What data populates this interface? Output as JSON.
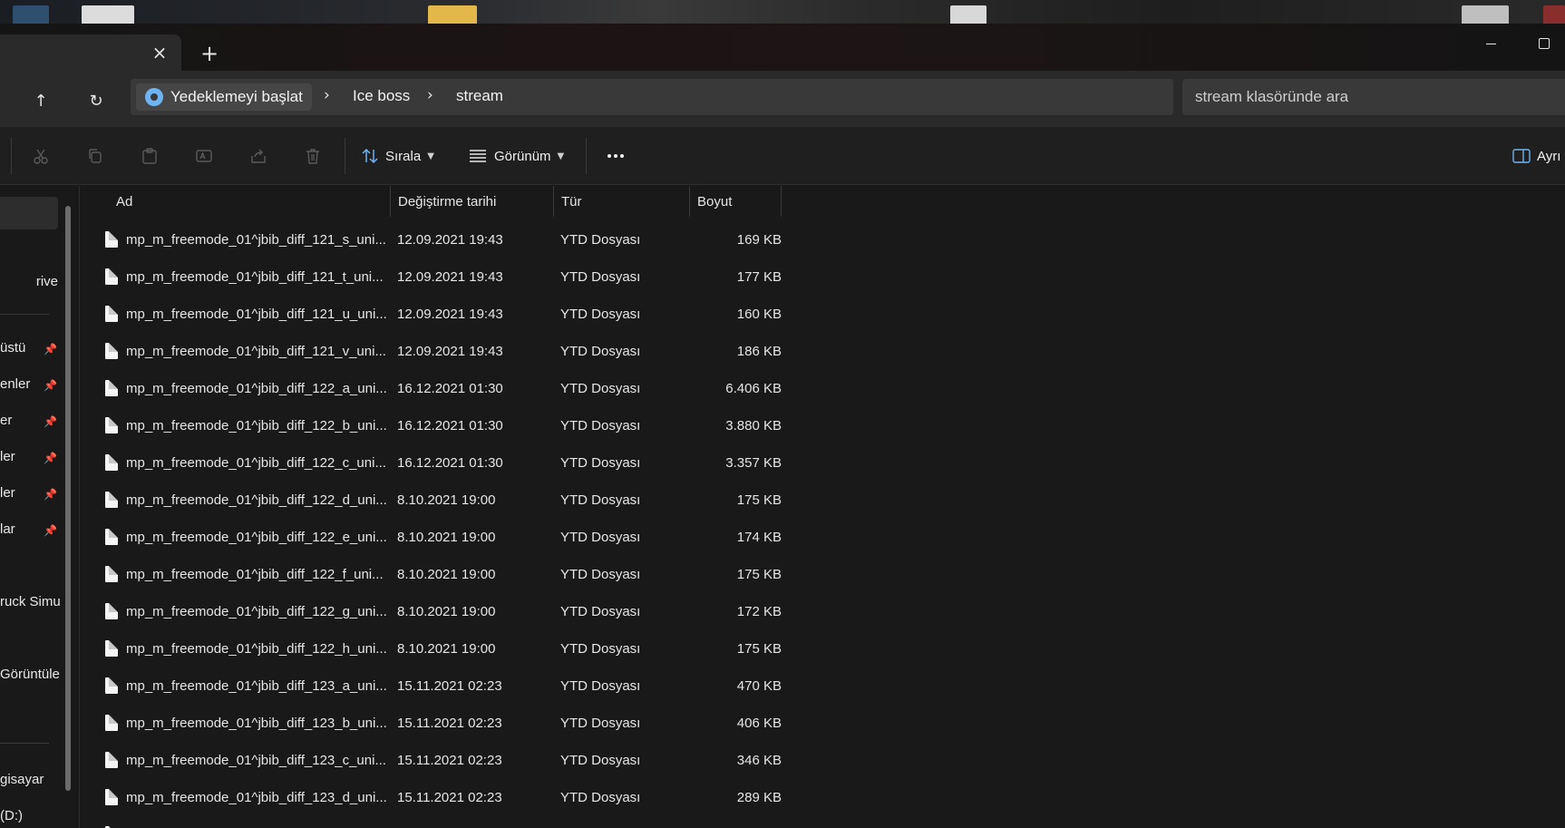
{
  "tab": {
    "close_glyph": "×",
    "new_tab_glyph": "+"
  },
  "nav": {
    "up_glyph": "↑",
    "refresh_glyph": "↻"
  },
  "breadcrumb": {
    "first": "Yedeklemeyi başlat",
    "items": [
      "Ice boss",
      "stream"
    ],
    "separator": "›"
  },
  "search": {
    "placeholder": "stream klasöründe ara"
  },
  "toolbar": {
    "sort_label": "Sırala",
    "view_label": "Görünüm",
    "details_label": "Ayrı"
  },
  "sidebar": {
    "items": [
      {
        "label": "rive"
      },
      {
        "label": "üstü",
        "pinned": true
      },
      {
        "label": "enler",
        "pinned": true
      },
      {
        "label": "er",
        "pinned": true
      },
      {
        "label": "ler",
        "pinned": true
      },
      {
        "label": "ler",
        "pinned": true
      },
      {
        "label": "lar",
        "pinned": true
      },
      {
        "label": "ruck Simu"
      },
      {
        "label": "Görüntüle"
      },
      {
        "label": "gisayar"
      },
      {
        "label": "(D:)"
      }
    ]
  },
  "columns": {
    "name": "Ad",
    "date": "Değiştirme tarihi",
    "type": "Tür",
    "size": "Boyut"
  },
  "files": [
    {
      "name": "mp_m_freemode_01^jbib_diff_121_s_uni...",
      "date": "12.09.2021 19:43",
      "type": "YTD Dosyası",
      "size": "169 KB"
    },
    {
      "name": "mp_m_freemode_01^jbib_diff_121_t_uni...",
      "date": "12.09.2021 19:43",
      "type": "YTD Dosyası",
      "size": "177 KB"
    },
    {
      "name": "mp_m_freemode_01^jbib_diff_121_u_uni...",
      "date": "12.09.2021 19:43",
      "type": "YTD Dosyası",
      "size": "160 KB"
    },
    {
      "name": "mp_m_freemode_01^jbib_diff_121_v_uni...",
      "date": "12.09.2021 19:43",
      "type": "YTD Dosyası",
      "size": "186 KB"
    },
    {
      "name": "mp_m_freemode_01^jbib_diff_122_a_uni...",
      "date": "16.12.2021 01:30",
      "type": "YTD Dosyası",
      "size": "6.406 KB"
    },
    {
      "name": "mp_m_freemode_01^jbib_diff_122_b_uni...",
      "date": "16.12.2021 01:30",
      "type": "YTD Dosyası",
      "size": "3.880 KB"
    },
    {
      "name": "mp_m_freemode_01^jbib_diff_122_c_uni...",
      "date": "16.12.2021 01:30",
      "type": "YTD Dosyası",
      "size": "3.357 KB"
    },
    {
      "name": "mp_m_freemode_01^jbib_diff_122_d_uni...",
      "date": "8.10.2021 19:00",
      "type": "YTD Dosyası",
      "size": "175 KB"
    },
    {
      "name": "mp_m_freemode_01^jbib_diff_122_e_uni...",
      "date": "8.10.2021 19:00",
      "type": "YTD Dosyası",
      "size": "174 KB"
    },
    {
      "name": "mp_m_freemode_01^jbib_diff_122_f_uni...",
      "date": "8.10.2021 19:00",
      "type": "YTD Dosyası",
      "size": "175 KB"
    },
    {
      "name": "mp_m_freemode_01^jbib_diff_122_g_uni...",
      "date": "8.10.2021 19:00",
      "type": "YTD Dosyası",
      "size": "172 KB"
    },
    {
      "name": "mp_m_freemode_01^jbib_diff_122_h_uni...",
      "date": "8.10.2021 19:00",
      "type": "YTD Dosyası",
      "size": "175 KB"
    },
    {
      "name": "mp_m_freemode_01^jbib_diff_123_a_uni...",
      "date": "15.11.2021 02:23",
      "type": "YTD Dosyası",
      "size": "470 KB"
    },
    {
      "name": "mp_m_freemode_01^jbib_diff_123_b_uni...",
      "date": "15.11.2021 02:23",
      "type": "YTD Dosyası",
      "size": "406 KB"
    },
    {
      "name": "mp_m_freemode_01^jbib_diff_123_c_uni...",
      "date": "15.11.2021 02:23",
      "type": "YTD Dosyası",
      "size": "346 KB"
    },
    {
      "name": "mp_m_freemode_01^jbib_diff_123_d_uni...",
      "date": "15.11.2021 02:23",
      "type": "YTD Dosyası",
      "size": "289 KB"
    }
  ],
  "colors": {
    "accent": "#6fb4f2",
    "background": "#191919",
    "toolbar": "#2a2a2a"
  }
}
